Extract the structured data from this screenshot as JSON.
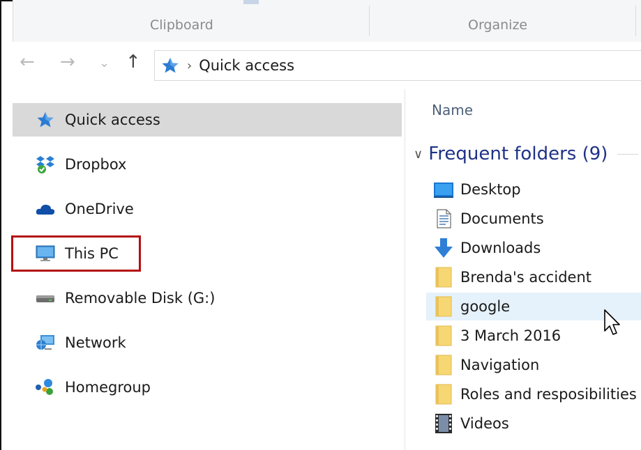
{
  "ribbon": {
    "groups": [
      "Clipboard",
      "Organize"
    ]
  },
  "navbar": {
    "back": "←",
    "forward": "→",
    "recent": "⌄",
    "up": "↑",
    "address": {
      "separator": "›",
      "path": "Quick access"
    }
  },
  "nav_pane": {
    "items": [
      {
        "label": "Quick access",
        "icon": "quick-access-star-icon",
        "selected": true
      },
      {
        "label": "Dropbox",
        "icon": "dropbox-icon"
      },
      {
        "label": "OneDrive",
        "icon": "onedrive-cloud-icon"
      },
      {
        "label": "This PC",
        "icon": "this-pc-monitor-icon",
        "highlighted": true
      },
      {
        "label": "Removable Disk (G:)",
        "icon": "removable-disk-icon"
      },
      {
        "label": "Network",
        "icon": "network-icon"
      },
      {
        "label": "Homegroup",
        "icon": "homegroup-icon"
      }
    ]
  },
  "content": {
    "column_header": "Name",
    "group": {
      "chevron": "∨",
      "title": "Frequent folders (9)"
    },
    "folders": [
      {
        "label": "Desktop",
        "icon": "desktop-folder-icon"
      },
      {
        "label": "Documents",
        "icon": "documents-folder-icon"
      },
      {
        "label": "Downloads",
        "icon": "downloads-arrow-icon"
      },
      {
        "label": "Brenda's accident",
        "icon": "folder-icon"
      },
      {
        "label": "google",
        "icon": "folder-icon",
        "hovered": true
      },
      {
        "label": "3 March 2016",
        "icon": "folder-icon"
      },
      {
        "label": "Navigation",
        "icon": "folder-icon"
      },
      {
        "label": "Roles and resposibilities",
        "icon": "folder-icon"
      },
      {
        "label": "Videos",
        "icon": "videos-folder-icon"
      }
    ]
  },
  "colors": {
    "highlight_border": "#b40f12",
    "selected_bg": "#d9d9d9",
    "hover_bg": "#e5f1fb",
    "group_title": "#1e3287"
  }
}
